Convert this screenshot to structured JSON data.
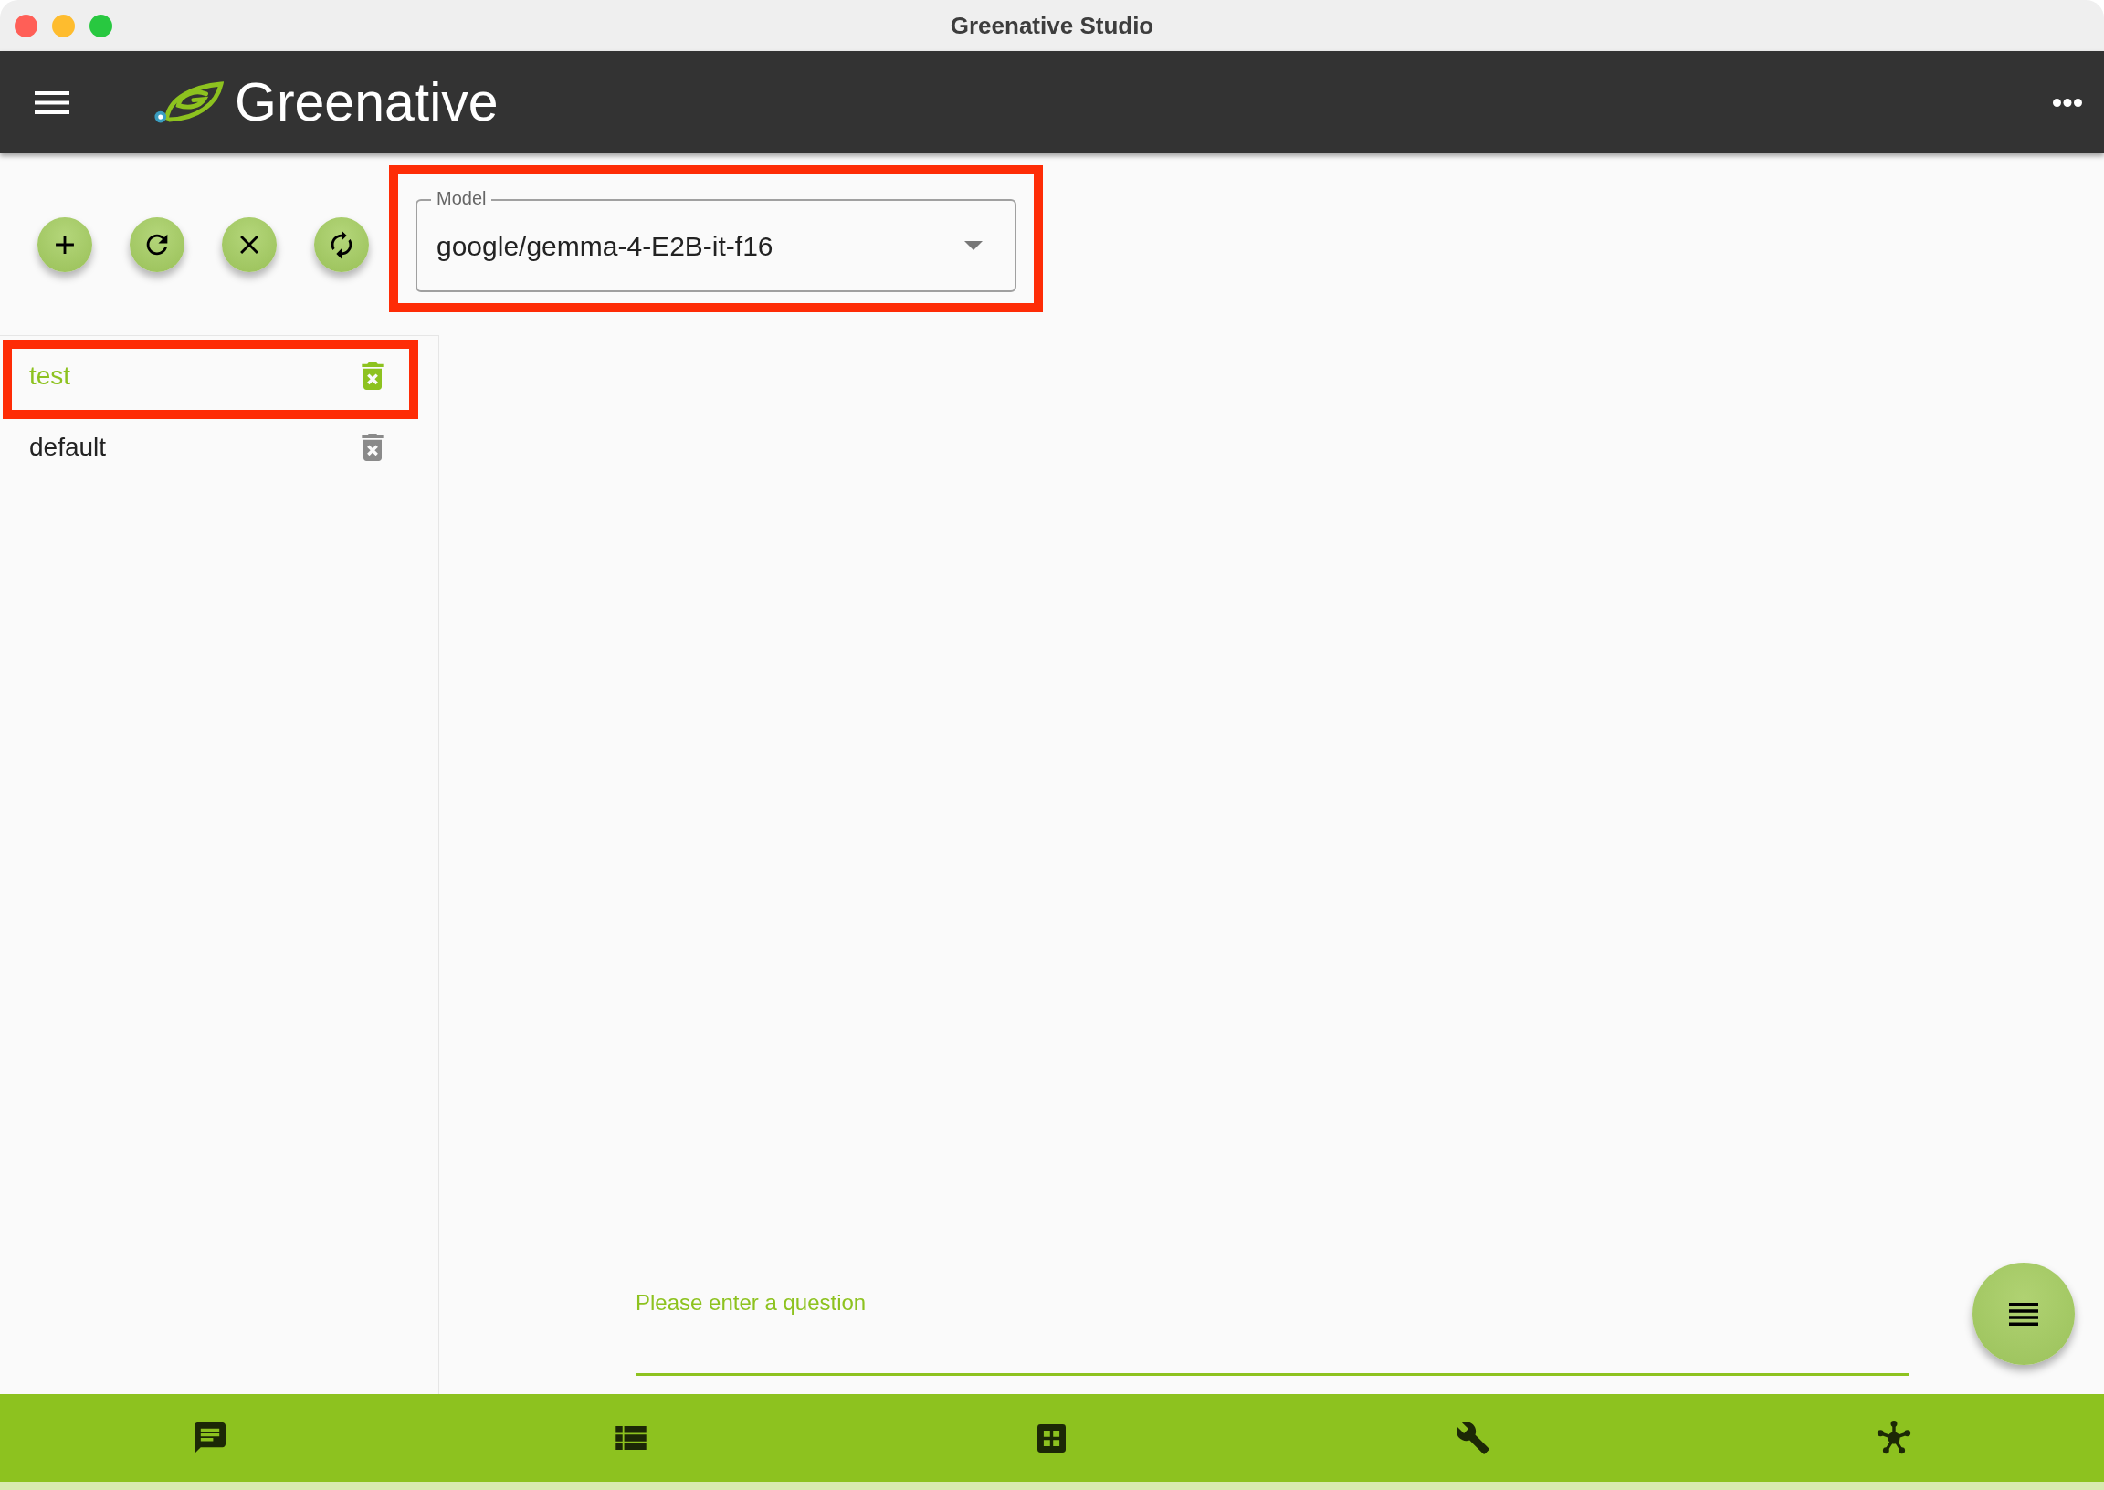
{
  "window": {
    "title": "Greenative Studio"
  },
  "header": {
    "logo_text": "Greenative"
  },
  "model_select": {
    "label": "Model",
    "value": "google/gemma-4-E2B-it-f16",
    "highlighted": true
  },
  "sessions": [
    {
      "name": "test",
      "selected": true,
      "highlighted": true
    },
    {
      "name": "default",
      "selected": false,
      "highlighted": false
    }
  ],
  "question_input": {
    "placeholder": "Please enter a question"
  }
}
